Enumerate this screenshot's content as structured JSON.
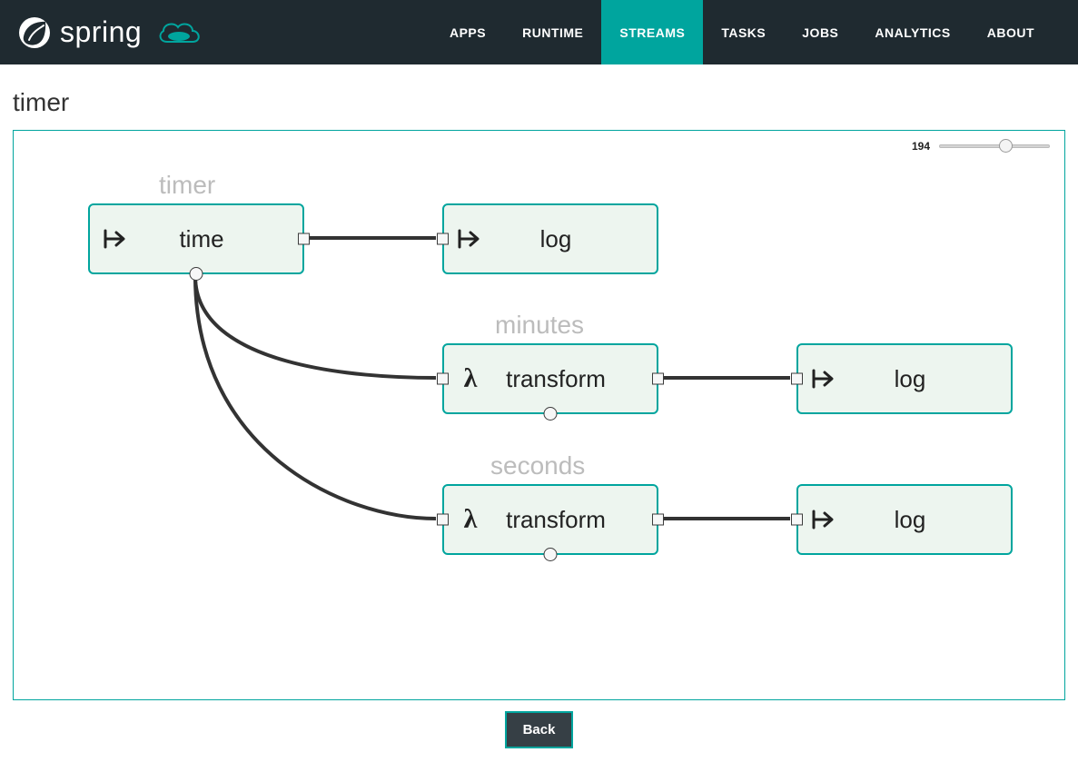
{
  "brand": {
    "name": "spring"
  },
  "nav": {
    "items": [
      {
        "label": "APPS",
        "active": false
      },
      {
        "label": "RUNTIME",
        "active": false
      },
      {
        "label": "STREAMS",
        "active": true
      },
      {
        "label": "TASKS",
        "active": false
      },
      {
        "label": "JOBS",
        "active": false
      },
      {
        "label": "ANALYTICS",
        "active": false
      },
      {
        "label": "ABOUT",
        "active": false
      }
    ]
  },
  "page": {
    "title": "timer"
  },
  "zoom": {
    "value": "194"
  },
  "streams": {
    "timer": {
      "label": "timer"
    },
    "minutes": {
      "label": "minutes"
    },
    "seconds": {
      "label": "seconds"
    }
  },
  "nodes": {
    "time": {
      "label": "time",
      "icon": "arrow"
    },
    "log1": {
      "label": "log",
      "icon": "arrow"
    },
    "transform_m": {
      "label": "transform",
      "icon": "lambda"
    },
    "log_m": {
      "label": "log",
      "icon": "arrow"
    },
    "transform_s": {
      "label": "transform",
      "icon": "lambda"
    },
    "log_s": {
      "label": "log",
      "icon": "arrow"
    }
  },
  "buttons": {
    "back": "Back"
  },
  "colors": {
    "accent": "#00a59e",
    "navbar": "#1f2a30",
    "nodeFill": "#edf5ef"
  }
}
